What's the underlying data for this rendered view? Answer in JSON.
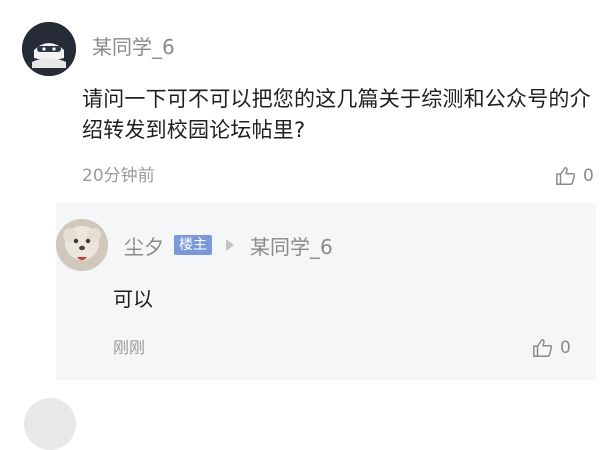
{
  "comment": {
    "username": "某同学_6",
    "text": "请问一下可不可以把您的这几篇关于综测和公众号的介绍转发到校园论坛帖里?",
    "time": "20分钟前",
    "like_count": "0"
  },
  "reply": {
    "username": "尘夕",
    "badge": "楼主",
    "target": "某同学_6",
    "text": "可以",
    "time": "刚刚",
    "like_count": "0"
  },
  "icons": {
    "like": "thumbs-up-icon",
    "reply_arrow": "triangle-right-icon"
  }
}
